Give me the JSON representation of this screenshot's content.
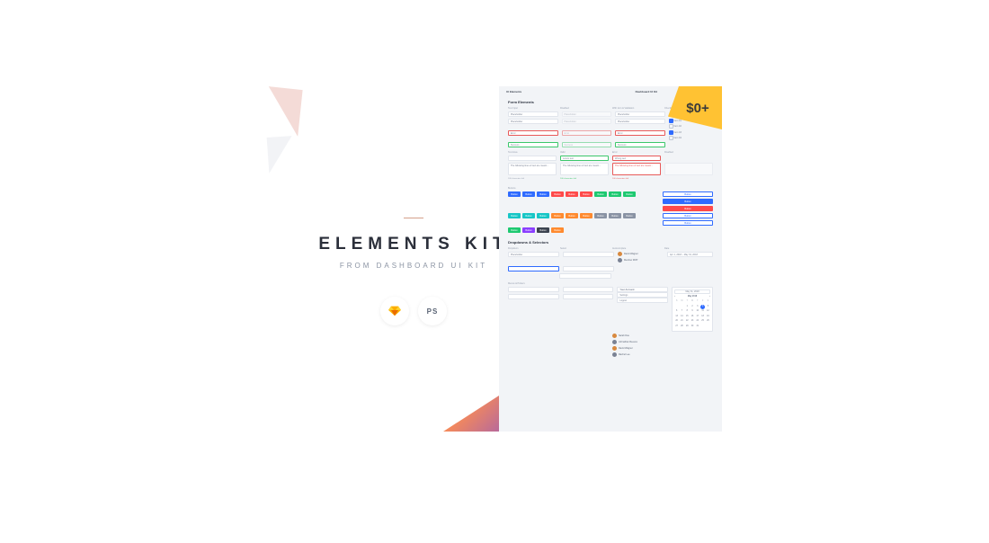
{
  "left": {
    "title": "ELEMENTS KIT",
    "subtitle": "FROM DASHBOARD UI KIT",
    "formats": {
      "sketch": "sketch",
      "ps": "PS"
    }
  },
  "price": "$0+",
  "panel": {
    "header_left": "UI Elements",
    "header_right": "Dashboard UI Kit",
    "section_form": "Form Elements",
    "col_labels": [
      "Text Input",
      "Disabled",
      "With Icon & Validation",
      "Checkboxes"
    ],
    "placeholder": "Placeholder",
    "error": "Error",
    "success": "Success",
    "checks": [
      "Item 01",
      "Item 02",
      "Item 03",
      "Item 04"
    ],
    "ta_section_labels": [
      "Text Area",
      "Valid",
      "Error",
      "Disabled"
    ],
    "ta_text": "The following lines of text are meant...",
    "ta_valid_title": "Lorem text",
    "ta_err_title": "Wrong text",
    "hint": "100 characters left",
    "section_buttons": "Buttons",
    "btn_label": "Button",
    "section_drop": "Dropdowns & Selectors",
    "drop_labels": [
      "Dropdown",
      "Select",
      "Autocomplete",
      "Date"
    ],
    "user1": "David Wagner",
    "user2": "Member MVP",
    "date_range": "Apr 1, 2018 – May 31, 2018",
    "date_single": "May 31, 2018",
    "section_menu": "Menus & Pickers",
    "menu_items": [
      "Your Account",
      "Settings",
      "Logout"
    ],
    "users": [
      "Sarah Doe",
      "Johnathan Reeves",
      "David Wagner",
      "Rachel Lee"
    ],
    "cal_title": "May 2018",
    "dow": [
      "S",
      "M",
      "T",
      "W",
      "T",
      "F",
      "S"
    ],
    "cal_sel": "4"
  }
}
